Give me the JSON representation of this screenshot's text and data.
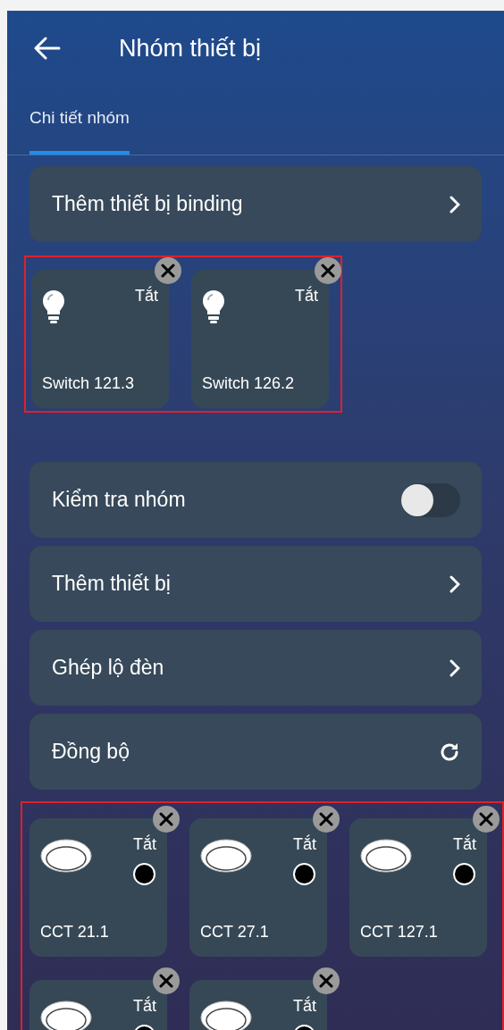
{
  "header": {
    "title": "Nhóm thiết bị"
  },
  "tabs": [
    {
      "label": "Chi tiết nhóm",
      "selected": true
    }
  ],
  "binding_item": {
    "label": "Thêm thiết bị binding",
    "kind": "chevron"
  },
  "binding_devices": {
    "highlighted": true,
    "items": [
      {
        "kind": "switch",
        "state": "Tắt",
        "name": "Switch 121.3"
      },
      {
        "kind": "switch",
        "state": "Tắt",
        "name": "Switch 126.2"
      }
    ]
  },
  "menu": [
    {
      "label": "Kiểm tra nhóm",
      "kind": "toggle",
      "on": false
    },
    {
      "label": "Thêm thiết bị",
      "kind": "chevron"
    },
    {
      "label": "Ghép lộ đèn",
      "kind": "chevron"
    },
    {
      "label": "Đồng bộ",
      "kind": "refresh"
    }
  ],
  "devices": {
    "highlighted": true,
    "items": [
      {
        "kind": "cct",
        "state": "Tắt",
        "name": "CCT 21.1"
      },
      {
        "kind": "cct",
        "state": "Tắt",
        "name": "CCT 27.1"
      },
      {
        "kind": "cct",
        "state": "Tắt",
        "name": "CCT 127.1"
      },
      {
        "kind": "cct",
        "state": "Tắt"
      },
      {
        "kind": "cct",
        "state": "Tắt"
      }
    ]
  }
}
